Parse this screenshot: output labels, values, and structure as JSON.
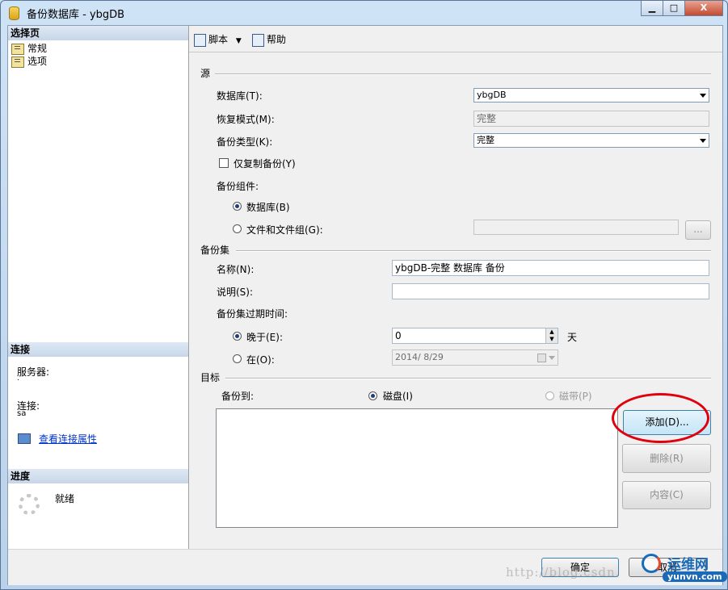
{
  "window": {
    "title": "备份数据库 - ybgDB",
    "controls": {
      "minimize": "▁",
      "maximize": "□",
      "close": "X"
    }
  },
  "left": {
    "select_page_header": "选择页",
    "nav": [
      {
        "label": "常规"
      },
      {
        "label": "选项"
      }
    ],
    "connection_header": "连接",
    "server_label": "服务器:",
    "server_value": ".",
    "connection_label": "连接:",
    "connection_value": "sa",
    "view_props_link": "查看连接属性",
    "progress_header": "进度",
    "progress_status": "就绪"
  },
  "toolbar": {
    "script_label": "脚本",
    "help_label": "帮助"
  },
  "source": {
    "header": "源",
    "database_label": "数据库(T):",
    "database_value": "ybgDB",
    "recovery_label": "恢复模式(M):",
    "recovery_value": "完整",
    "backup_type_label": "备份类型(K):",
    "backup_type_value": "完整",
    "copy_only_label": "仅复制备份(Y)",
    "component_label": "备份组件:",
    "component_db": "数据库(B)",
    "component_files": "文件和文件组(G):",
    "files_button": "..."
  },
  "backup_set": {
    "header": "备份集",
    "name_label": "名称(N):",
    "name_value": "ybgDB-完整 数据库 备份",
    "desc_label": "说明(S):",
    "desc_value": "",
    "expire_label": "备份集过期时间:",
    "after_label": "晚于(E):",
    "after_value": "0",
    "days_unit": "天",
    "on_label": "在(O):",
    "on_value": "2014/ 8/29"
  },
  "destination": {
    "header": "目标",
    "backup_to_label": "备份到:",
    "disk_label": "磁盘(I)",
    "tape_label": "磁带(P)",
    "add_button": "添加(D)...",
    "remove_button": "删除(R)",
    "contents_button": "内容(C)"
  },
  "footer": {
    "ok_button": "确定",
    "cancel_button": "取消"
  },
  "watermark": {
    "url": "http://blog.csdn.",
    "logo_text": "运维网",
    "logo_domain": "yunvn.com"
  },
  "colors": {
    "annotation_circle": "#e0000e",
    "link": "#0033cc",
    "logo_blue": "#1a6ab8"
  }
}
